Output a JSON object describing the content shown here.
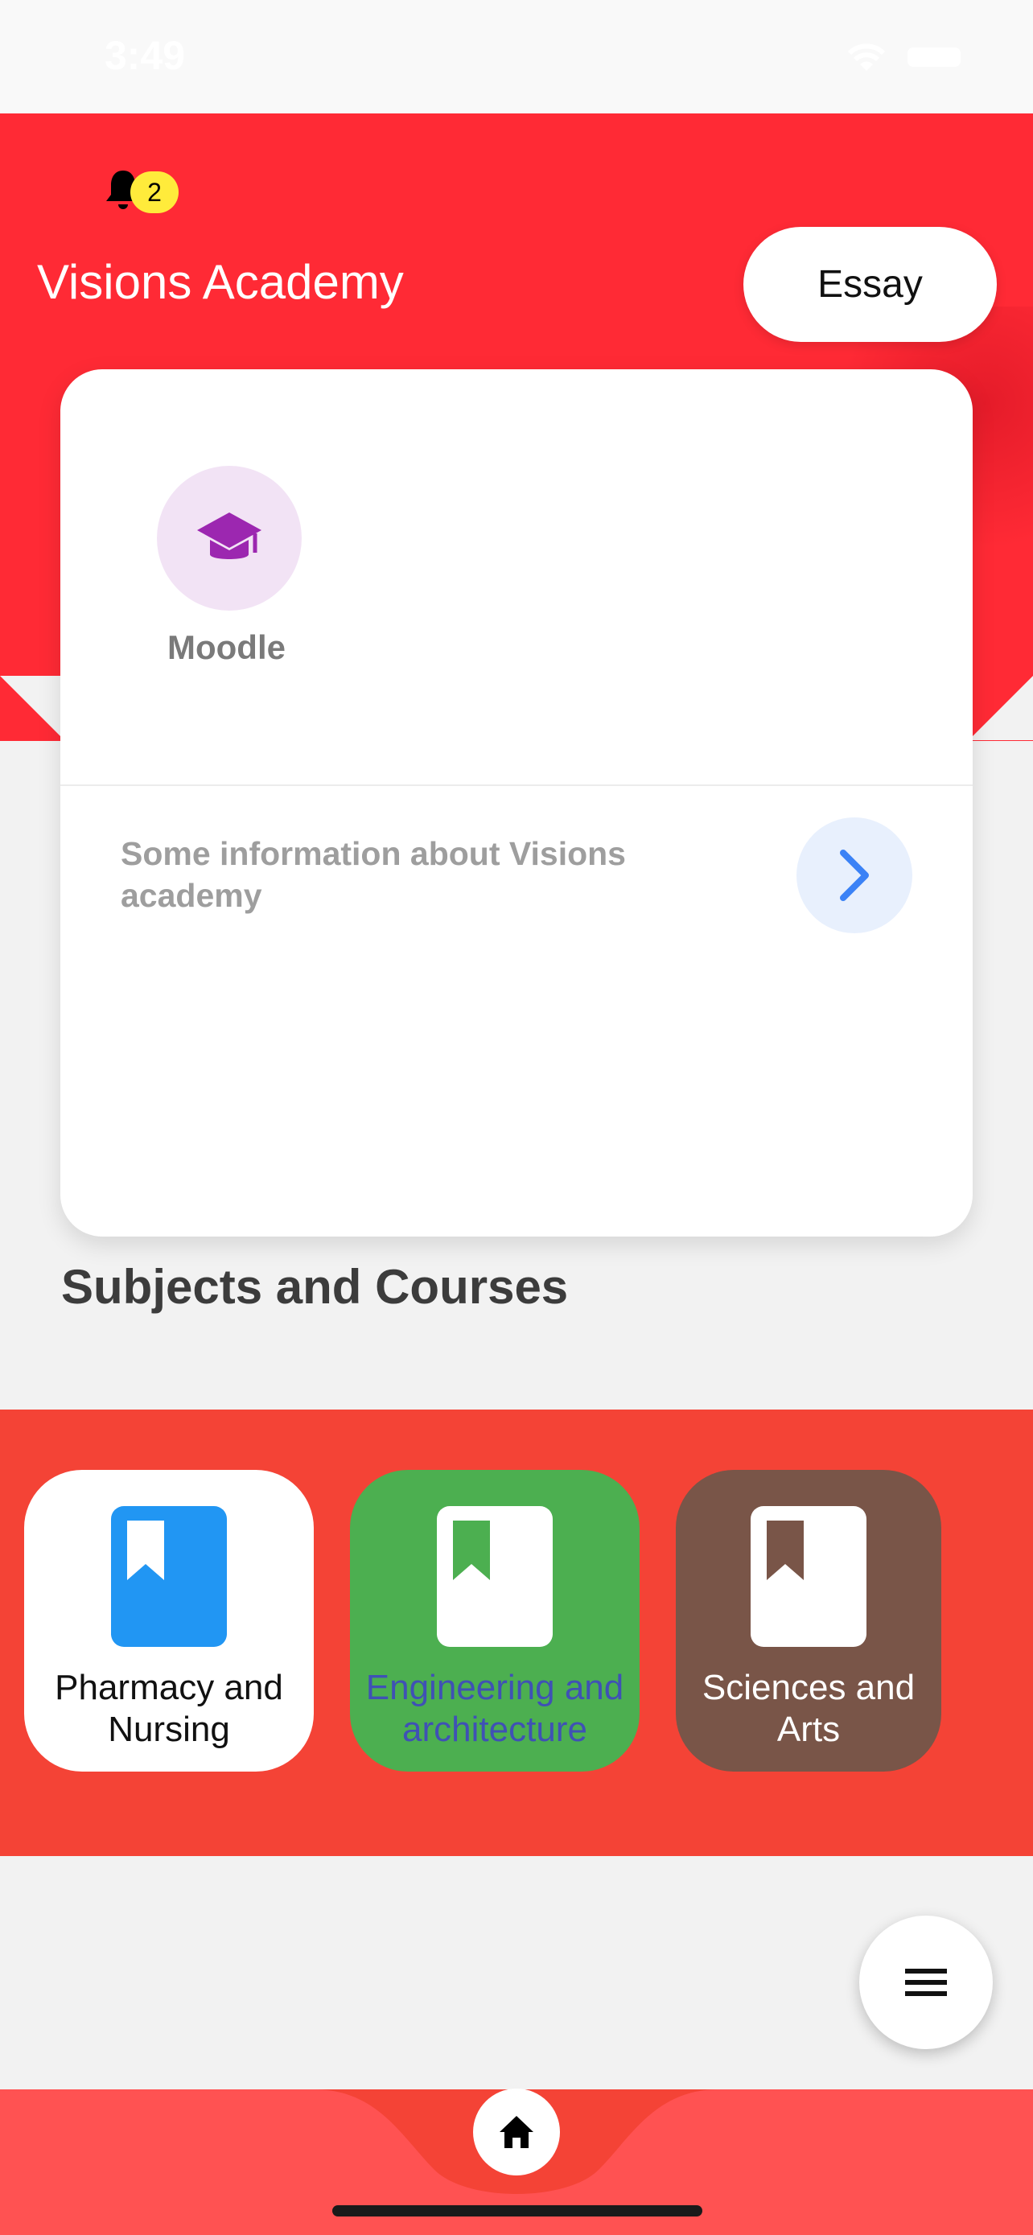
{
  "status_bar": {
    "time": "3:49"
  },
  "header": {
    "app_title": "Visions Academy",
    "notification_count": "2",
    "essay_button": "Essay"
  },
  "card": {
    "moodle_label": "Moodle",
    "info_text": "Some information about Visions academy"
  },
  "section": {
    "title": "Subjects and Courses"
  },
  "courses": [
    {
      "label": "Pharmacy and Nursing",
      "color": "#ffffff"
    },
    {
      "label": "Engineering and architecture",
      "color": "#4caf50"
    },
    {
      "label": "Sciences and Arts",
      "color": "#795548"
    }
  ],
  "colors": {
    "header": "#ff2a35",
    "courses_band": "#f44336",
    "bottom_nav": "#ff5252",
    "moodle_icon": "#9c27b0",
    "info_arrow": "#3b82f6"
  },
  "icons": {
    "notification": "bell-icon",
    "moodle": "graduation-cap-icon",
    "info": "chevron-right-icon",
    "course": "bookmark-book-icon",
    "menu": "hamburger-menu-icon",
    "home": "home-icon"
  }
}
